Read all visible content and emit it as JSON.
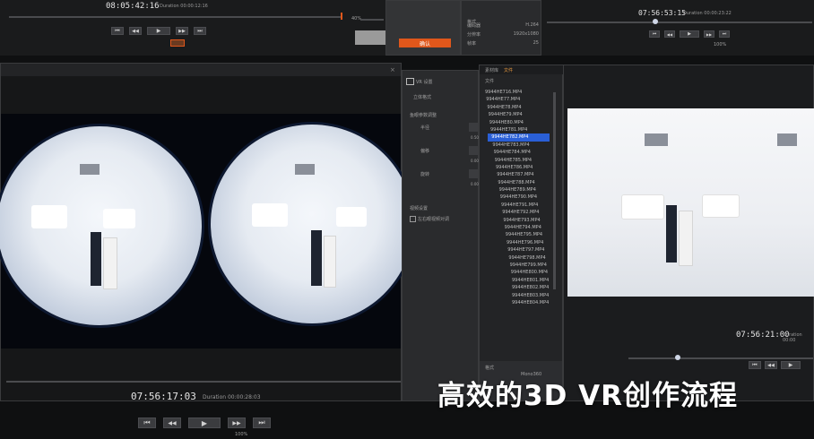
{
  "top_left": {
    "timecode": "08:05:42:16",
    "duration": "Duration 00:00:12:16",
    "zoom_value": "40%",
    "orange_button": "确认"
  },
  "top_middle": {
    "rows": [
      {
        "label": "格式",
        "value": ""
      },
      {
        "label": "编码器",
        "value": "H.264"
      },
      {
        "label": "分辨率",
        "value": "1920x1080"
      },
      {
        "label": "帧率",
        "value": "25"
      }
    ]
  },
  "top_right": {
    "timecode": "07:56:53:15",
    "duration": "Duration 00:00:23:22",
    "zoom_value": "100%"
  },
  "left_viewer": {
    "timecode": "07:56:17:03",
    "duration": "Duration 00:00:28:03",
    "zoom_value": "100%"
  },
  "settings_panel": {
    "title": "VR 设置",
    "subtitle": "立体格式",
    "section1": "鱼眼参数调整",
    "rows": [
      {
        "label": "半径",
        "value": "0.50"
      },
      {
        "label": "偏移",
        "value": "0.00"
      },
      {
        "label": "旋转",
        "value": "0.00"
      }
    ],
    "section2": "视频设置",
    "checkbox_label": "左右眼视频对调"
  },
  "file_browser": {
    "tabs": [
      "素材库",
      "文件"
    ],
    "path": "文件",
    "items": [
      "9944HE716.MP4",
      "9944HE77.MP4",
      "9944HE78.MP4",
      "9944HE79.MP4",
      "9944HE80.MP4",
      "9944HE781.MP4",
      "9944HE782.MP4",
      "9944HE783.MP4",
      "9944HE784.MP4",
      "9944HE785.MP4",
      "9944HE786.MP4",
      "9944HE787.MP4",
      "9944HE788.MP4",
      "9944HE789.MP4",
      "9944HE790.MP4",
      "9944HE791.MP4",
      "9944HE792.MP4",
      "9944HE793.MP4",
      "9944HE794.MP4",
      "9944HE795.MP4",
      "9944HE796.MP4",
      "9944HE797.MP4",
      "9944HE798.MP4",
      "9944HE799.MP4",
      "9944HE800.MP4",
      "9944HE801.MP4",
      "9944HE802.MP4",
      "9944HE803.MP4",
      "9944HE804.MP4"
    ],
    "selected_index": 6,
    "footer_label": "格式",
    "footer_value": "Mono360"
  },
  "right_viewer": {
    "timecode": "07:56:21:00",
    "duration": "Duration 00:00"
  },
  "overlay": {
    "slogan": "高效的3D VR创作流程"
  },
  "icons": {
    "prev": "⏮",
    "step_back": "◀◀",
    "play": "▶",
    "step_fwd": "▶▶",
    "next": "⏭"
  },
  "colors": {
    "accent": "#e0571b",
    "selection": "#2a5fd6",
    "panel": "#2a2b2d",
    "background": "#0f1011"
  }
}
